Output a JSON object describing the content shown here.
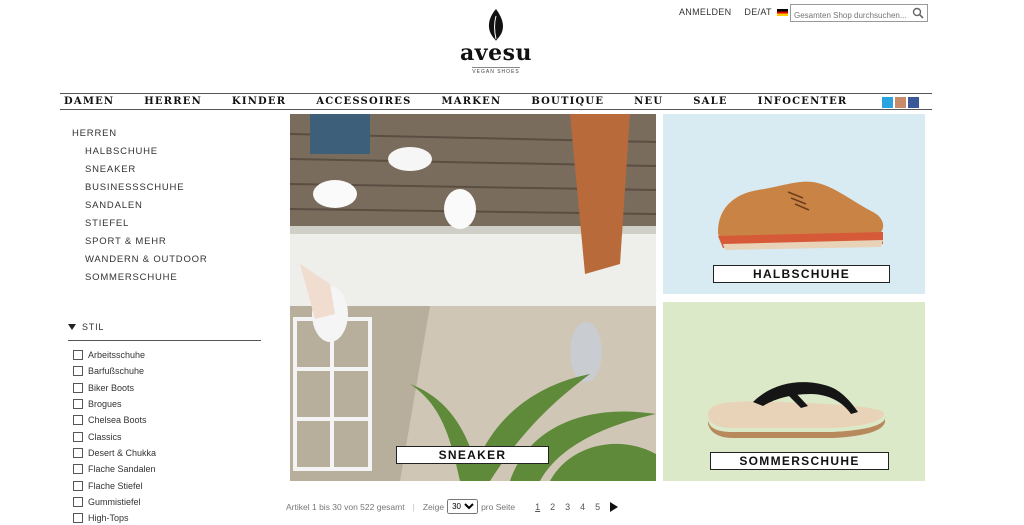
{
  "header": {
    "login_label": "ANMELDEN",
    "language_label": "DE/AT",
    "search_placeholder": "Gesamten Shop durchsuchen...",
    "brand_name": "avesu",
    "brand_tagline": "VEGAN SHOES"
  },
  "nav": {
    "items": [
      "DAMEN",
      "HERREN",
      "KINDER",
      "ACCESSOIRES",
      "MARKEN",
      "BOUTIQUE",
      "NEU",
      "SALE",
      "INFOCENTER"
    ],
    "social_icons": [
      "twitter-icon",
      "instagram-icon",
      "facebook-icon"
    ]
  },
  "sidebar": {
    "category": "HERREN",
    "subcategories": [
      "HALBSCHUHE",
      "SNEAKER",
      "BUSINESSSCHUHE",
      "SANDALEN",
      "STIEFEL",
      "SPORT & MEHR",
      "WANDERN & OUTDOOR",
      "SOMMERSCHUHE"
    ],
    "filter_title": "STIL",
    "filters": [
      "Arbeitsschuhe",
      "Barfußschuhe",
      "Biker Boots",
      "Brogues",
      "Chelsea Boots",
      "Classics",
      "Desert & Chukka",
      "Flache Sandalen",
      "Flache Stiefel",
      "Gummistiefel",
      "High-Tops"
    ]
  },
  "tiles": {
    "big_label": "SNEAKER",
    "top_right_label": "HALBSCHUHE",
    "bottom_right_label": "SOMMERSCHUHE"
  },
  "pager": {
    "count_text": "Artikel 1 bis 30 von 522 gesamt",
    "show_label": "Zeige",
    "per_page_value": "30",
    "per_page_suffix": "pro Seite",
    "pages": [
      "1",
      "2",
      "3",
      "4",
      "5"
    ],
    "current_page": "1"
  },
  "colors": {
    "tile_blue": "#d8ebf3",
    "tile_green": "#dbe9c8",
    "twitter": "#2aa3df",
    "facebook": "#3b5998"
  }
}
